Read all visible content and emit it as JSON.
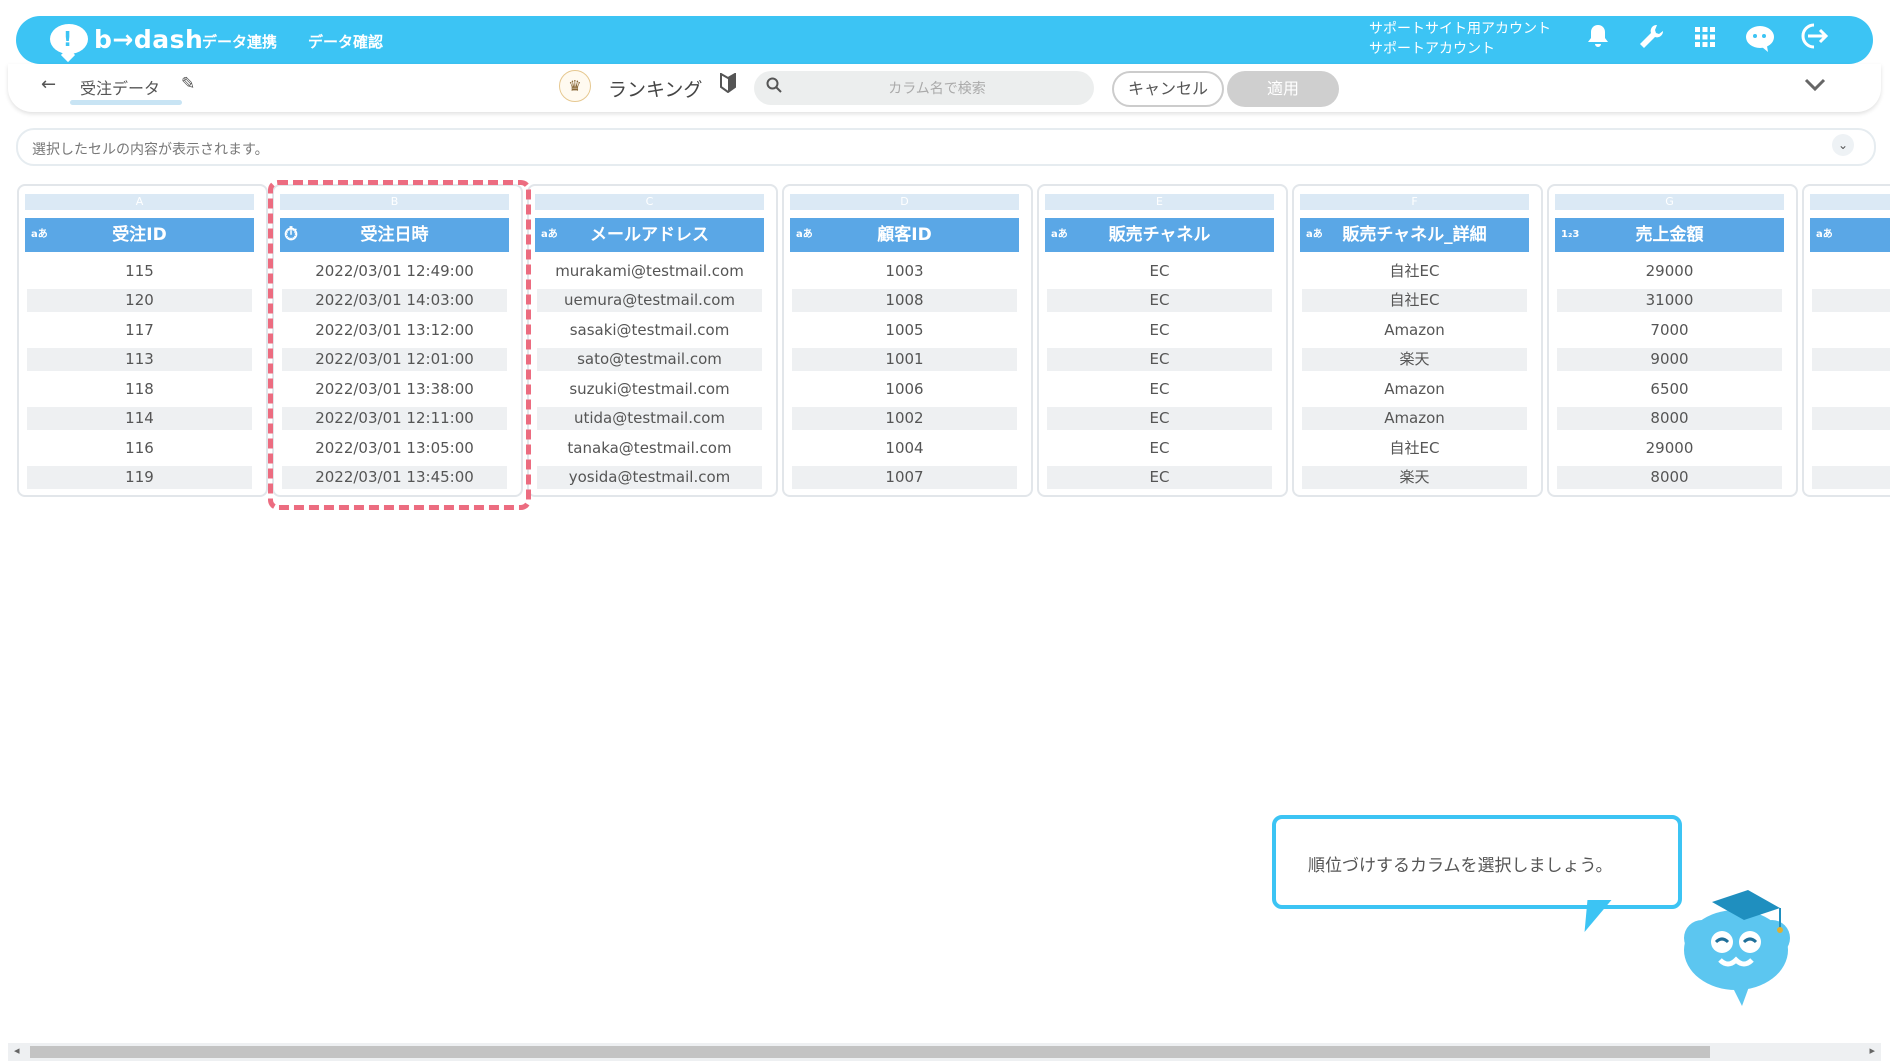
{
  "header": {
    "logo_mark": "!",
    "logo_text": "b→dash",
    "nav": [
      "データ連携",
      "データ確認"
    ],
    "account_line1": "サポートサイト用アカウント",
    "account_line2": "サポートアカウント",
    "icons": [
      "bell-icon",
      "wrench-icon",
      "grid-icon",
      "chat-bot-icon",
      "logout-icon"
    ]
  },
  "toolbar": {
    "back_glyph": "←",
    "data_name": "受注データ",
    "mode_label": "ランキング",
    "search_placeholder": "カラム名で検索",
    "cancel_label": "キャンセル",
    "apply_label": "適用"
  },
  "cell_bar": {
    "placeholder": "選択したセルの内容が表示されます。"
  },
  "columns": [
    {
      "letter": "A",
      "type": "aあ",
      "name": "受注ID",
      "cells": [
        "115",
        "120",
        "117",
        "113",
        "118",
        "114",
        "116",
        "119"
      ]
    },
    {
      "letter": "B",
      "type": "⏱",
      "name": "受注日時",
      "cells": [
        "2022/03/01 12:49:00",
        "2022/03/01 14:03:00",
        "2022/03/01 13:12:00",
        "2022/03/01 12:01:00",
        "2022/03/01 13:38:00",
        "2022/03/01 12:11:00",
        "2022/03/01 13:05:00",
        "2022/03/01 13:45:00"
      ]
    },
    {
      "letter": "C",
      "type": "aあ",
      "name": "メールアドレス",
      "cells": [
        "murakami@testmail.com",
        "uemura@testmail.com",
        "sasaki@testmail.com",
        "sato@testmail.com",
        "suzuki@testmail.com",
        "utida@testmail.com",
        "tanaka@testmail.com",
        "yosida@testmail.com"
      ]
    },
    {
      "letter": "D",
      "type": "aあ",
      "name": "顧客ID",
      "cells": [
        "1003",
        "1008",
        "1005",
        "1001",
        "1006",
        "1002",
        "1004",
        "1007"
      ]
    },
    {
      "letter": "E",
      "type": "aあ",
      "name": "販売チャネル",
      "cells": [
        "EC",
        "EC",
        "EC",
        "EC",
        "EC",
        "EC",
        "EC",
        "EC"
      ]
    },
    {
      "letter": "F",
      "type": "aあ",
      "name": "販売チャネル_詳細",
      "cells": [
        "自社EC",
        "自社EC",
        "Amazon",
        "楽天",
        "Amazon",
        "Amazon",
        "自社EC",
        "楽天"
      ]
    },
    {
      "letter": "G",
      "type": "1₂3",
      "name": "売上金額",
      "cells": [
        "29000",
        "31000",
        "7000",
        "9000",
        "6500",
        "8000",
        "29000",
        "8000"
      ]
    },
    {
      "letter": "H",
      "type": "aあ",
      "name": "",
      "cells": [
        "",
        "",
        "",
        "",
        "",
        "",
        "",
        ""
      ]
    }
  ],
  "tooltip": {
    "text": "順位づけするカラムを選択しましょう。"
  },
  "colors": {
    "brand": "#3cc4f4",
    "header_cell": "#5aa7e6",
    "highlight": "#ec6c80"
  }
}
